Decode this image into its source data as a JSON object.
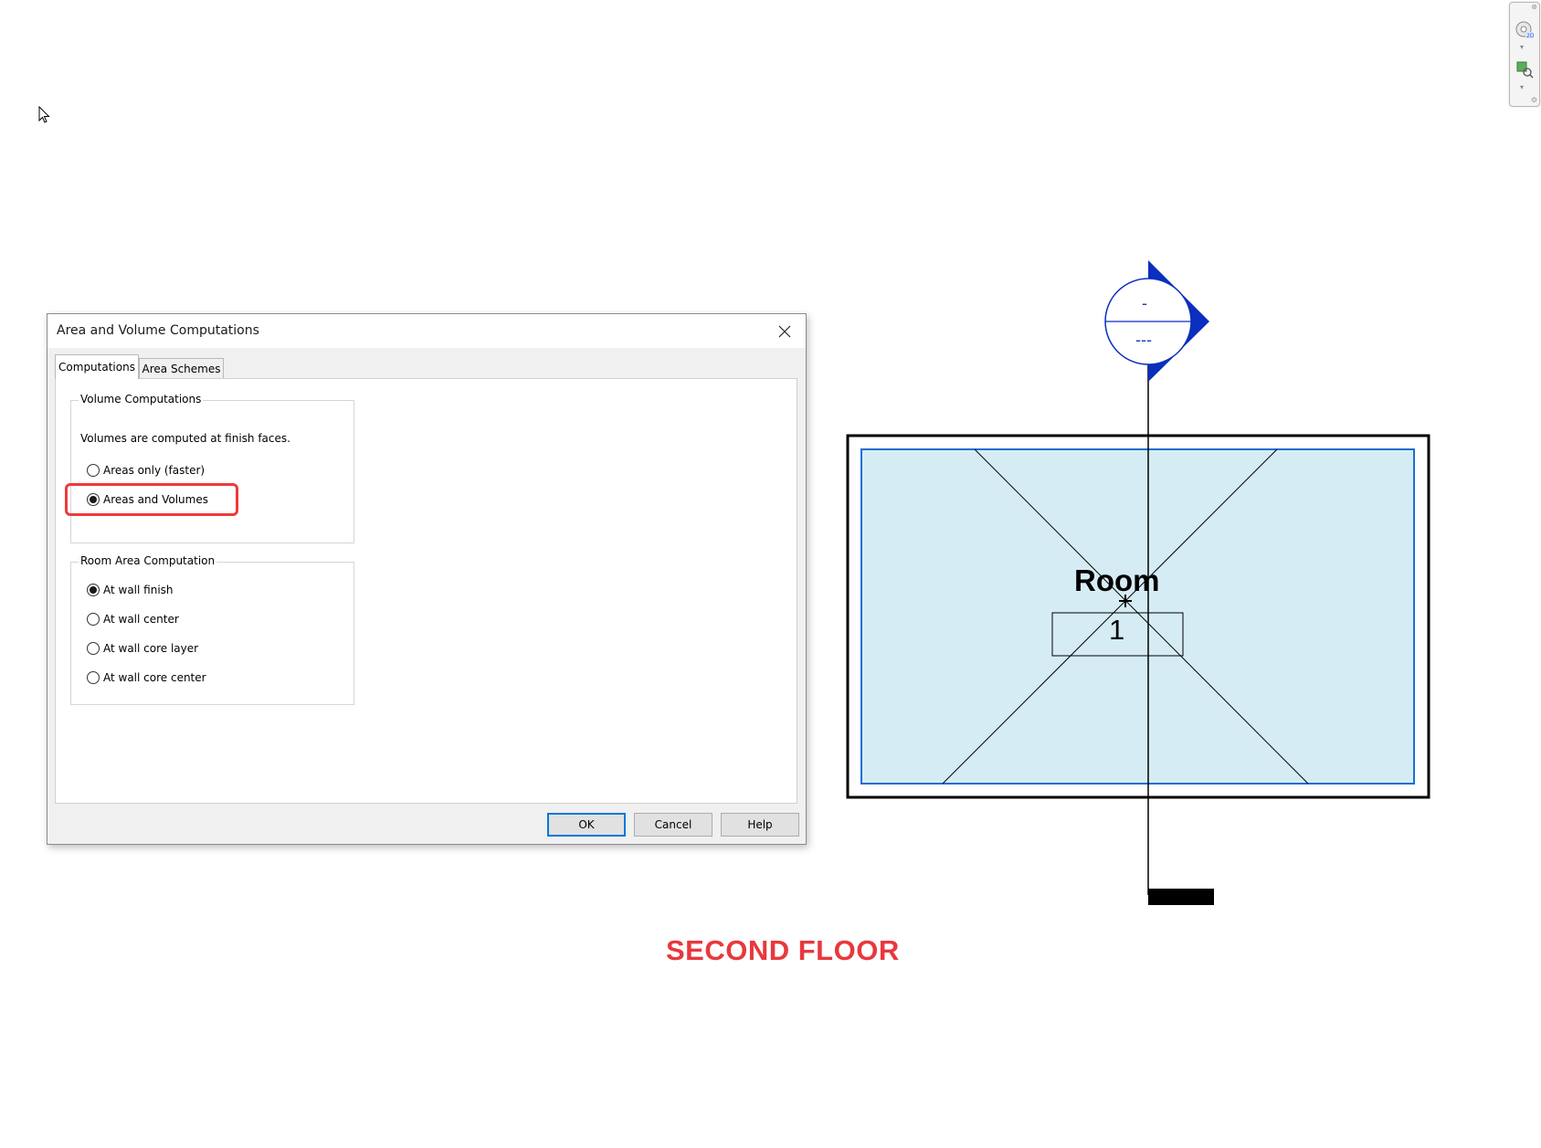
{
  "dialog": {
    "title": "Area and Volume Computations",
    "tabs": [
      {
        "label": "Computations",
        "active": true
      },
      {
        "label": "Area Schemes",
        "active": false
      }
    ],
    "volume_group": {
      "legend": "Volume Computations",
      "note": "Volumes are computed at finish faces.",
      "options": [
        {
          "label": "Areas only (faster)",
          "checked": false
        },
        {
          "label": "Areas and Volumes",
          "checked": true
        }
      ]
    },
    "room_area_group": {
      "legend": "Room Area Computation",
      "options": [
        {
          "label": "At wall finish",
          "checked": true
        },
        {
          "label": "At wall center",
          "checked": false
        },
        {
          "label": "At wall core layer",
          "checked": false
        },
        {
          "label": "At wall core center",
          "checked": false
        }
      ]
    },
    "buttons": {
      "ok": "OK",
      "cancel": "Cancel",
      "help": "Help"
    }
  },
  "drawing": {
    "section_top": "-",
    "section_bottom": "---",
    "room_name": "Room",
    "room_number": "1",
    "floor_label": "SECOND FLOOR"
  },
  "colors": {
    "room_fill": "#d6ecf5",
    "room_border": "#1a6fd1",
    "section_marker": "#0a2fbd",
    "highlight": "#ee3a3a",
    "floor_label": "#e8383d"
  }
}
